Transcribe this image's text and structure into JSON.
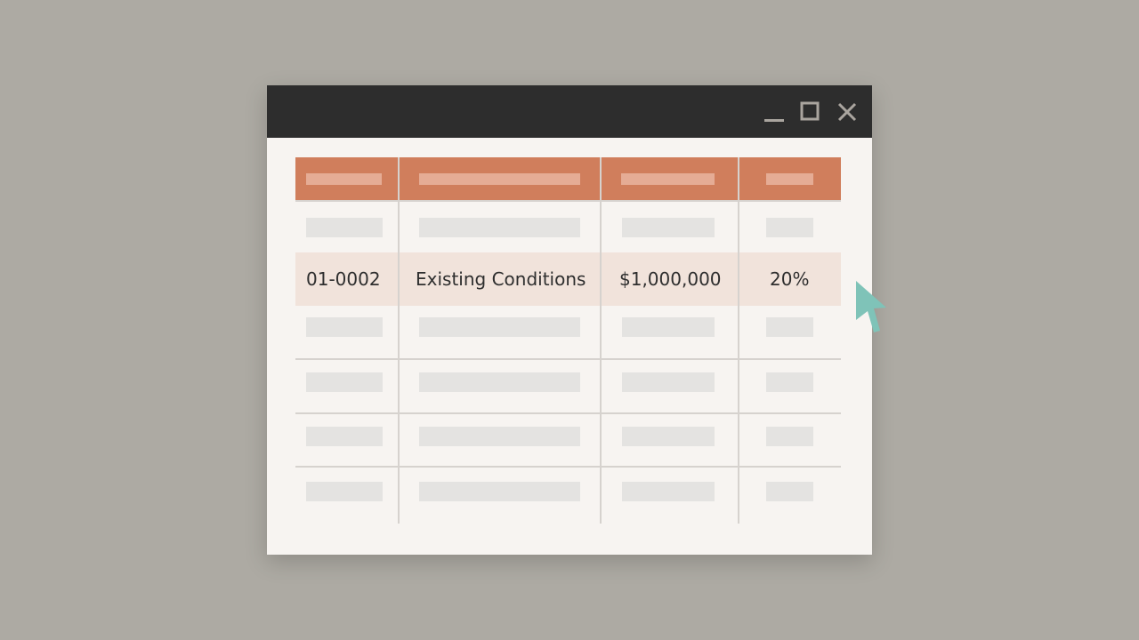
{
  "window": {
    "controls": {
      "minimize_icon": "minimize-icon",
      "maximize_icon": "maximize-icon",
      "close_icon": "close-icon"
    }
  },
  "table": {
    "selected_row": {
      "code": "01-0002",
      "description": "Existing Conditions",
      "amount": "$1,000,000",
      "percent": "20%"
    }
  },
  "colors": {
    "background": "#adaaa3",
    "titlebar": "#2d2d2d",
    "window_body": "#f7f4f1",
    "header_accent": "#d07e5c",
    "selected_row": "#f1e3db",
    "cursor": "#7fc3b8"
  }
}
